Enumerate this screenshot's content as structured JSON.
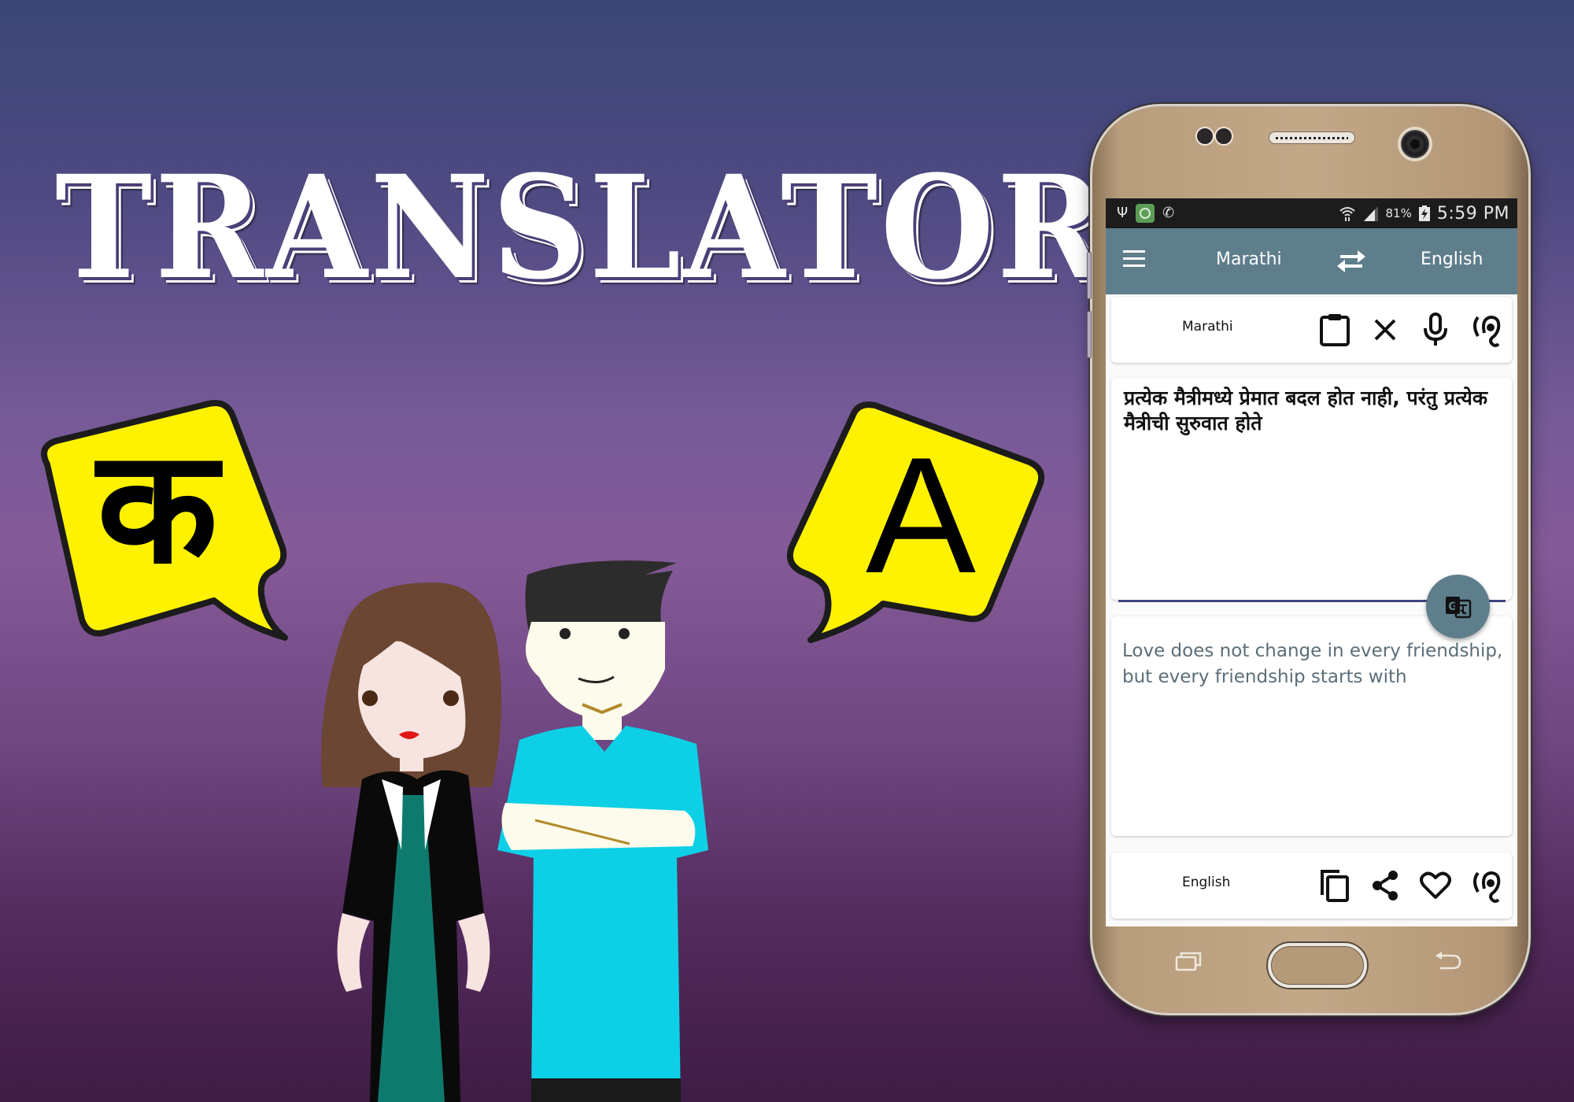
{
  "banner": {
    "title": "TRANSLATOR",
    "bubble_left_glyph": "क",
    "bubble_right_glyph": "A"
  },
  "colors": {
    "bubble_fill": "#fff200",
    "app_bar": "#5f7e8c",
    "input_underline": "#3f4680",
    "output_text": "#5b6e79"
  },
  "status_bar": {
    "left_icons": [
      "usb-icon",
      "app-notification-icon",
      "missed-call-icon"
    ],
    "battery_percent": "81%",
    "time": "5:59 PM"
  },
  "app_bar": {
    "menu_icon": "hamburger-menu-icon",
    "source_language": "Marathi",
    "swap_icon": "swap-arrows-icon",
    "target_language": "English"
  },
  "source_card": {
    "language_label": "Marathi",
    "actions": [
      {
        "name": "paste",
        "icon": "clipboard-icon"
      },
      {
        "name": "clear",
        "icon": "close-icon"
      },
      {
        "name": "voice-input",
        "icon": "microphone-icon"
      },
      {
        "name": "speak",
        "icon": "ear-listen-icon"
      }
    ]
  },
  "input": {
    "text": "प्रत्येक मैत्रीमध्ये प्रेमात बदल होत नाही, परंतु प्रत्येक मैत्रीची सुरुवात होते"
  },
  "translate_button": {
    "icon": "google-translate-icon"
  },
  "output": {
    "text": "Love does not change in every friendship, but every friendship starts with"
  },
  "target_card": {
    "language_label": "English",
    "actions": [
      {
        "name": "copy",
        "icon": "copy-icon"
      },
      {
        "name": "share",
        "icon": "share-icon"
      },
      {
        "name": "favorite",
        "icon": "heart-icon"
      },
      {
        "name": "speak",
        "icon": "ear-listen-icon"
      }
    ]
  },
  "device_nav": {
    "recent": "recent-apps-icon",
    "home": "home-button",
    "back": "back-icon"
  }
}
